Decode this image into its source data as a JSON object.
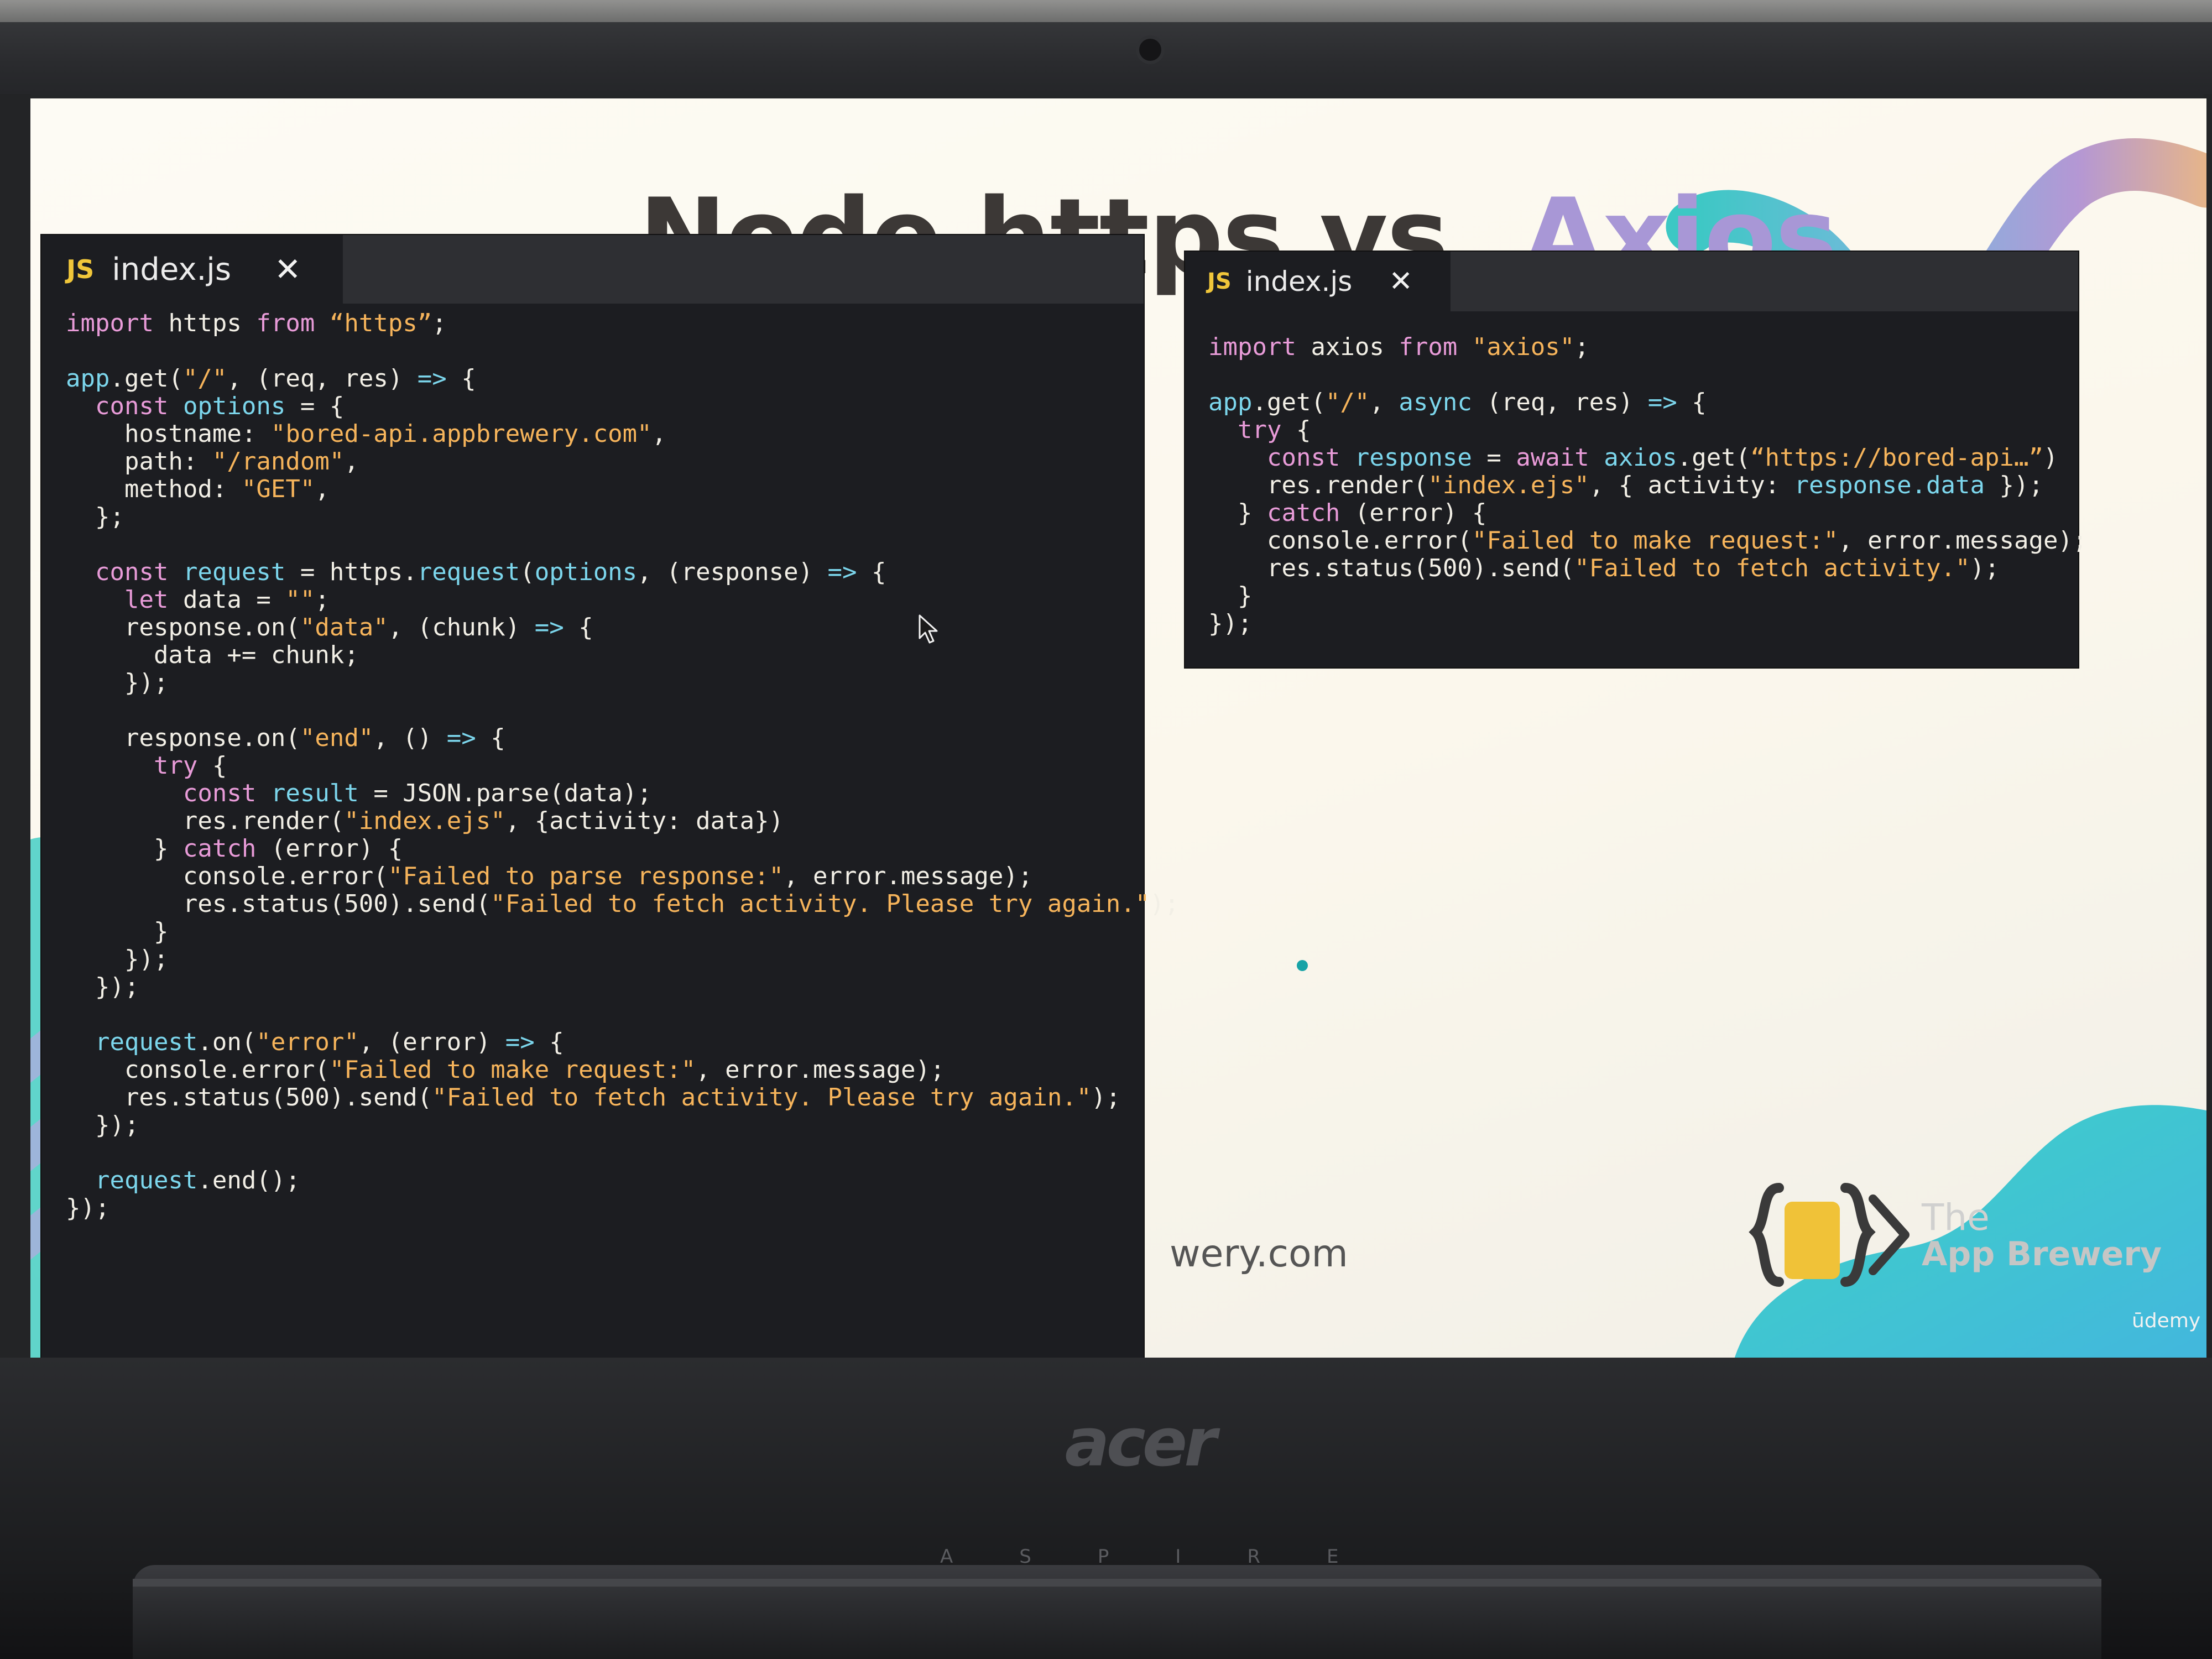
{
  "slide": {
    "title_main": "Node https vs. ",
    "title_accent": "Axios",
    "footer_url": "wery.com",
    "brand_line1": "The",
    "brand_line2": "App Brewery",
    "platform": "ūdemy"
  },
  "laptop": {
    "brand": "acer",
    "series": "ASPIRE"
  },
  "editors": {
    "left": {
      "tab_label": "index.js",
      "tab_icon": "JS",
      "lines": [
        [
          {
            "t": "import",
            "c": "kw"
          },
          {
            "t": " https ",
            "c": "pl"
          },
          {
            "t": "from",
            "c": "kw"
          },
          {
            "t": " “https”",
            "c": "str"
          },
          {
            "t": ";",
            "c": "pl"
          }
        ],
        [],
        [
          {
            "t": "app",
            "c": "var"
          },
          {
            "t": ".get(",
            "c": "pl"
          },
          {
            "t": "\"/\"",
            "c": "str"
          },
          {
            "t": ", (req, res) ",
            "c": "pl"
          },
          {
            "t": "=>",
            "c": "var"
          },
          {
            "t": " {",
            "c": "pl"
          }
        ],
        [
          {
            "t": "  ",
            "c": "pl"
          },
          {
            "t": "const",
            "c": "kw"
          },
          {
            "t": " ",
            "c": "pl"
          },
          {
            "t": "options",
            "c": "var"
          },
          {
            "t": " = {",
            "c": "pl"
          }
        ],
        [
          {
            "t": "    hostname: ",
            "c": "pl"
          },
          {
            "t": "\"bored-api.appbrewery.com\"",
            "c": "str"
          },
          {
            "t": ",",
            "c": "pl"
          }
        ],
        [
          {
            "t": "    path: ",
            "c": "pl"
          },
          {
            "t": "\"/random\"",
            "c": "str"
          },
          {
            "t": ",",
            "c": "pl"
          }
        ],
        [
          {
            "t": "    method: ",
            "c": "pl"
          },
          {
            "t": "\"GET\"",
            "c": "str"
          },
          {
            "t": ",",
            "c": "pl"
          }
        ],
        [
          {
            "t": "  };",
            "c": "pl"
          }
        ],
        [],
        [
          {
            "t": "  ",
            "c": "pl"
          },
          {
            "t": "const",
            "c": "kw"
          },
          {
            "t": " ",
            "c": "pl"
          },
          {
            "t": "request",
            "c": "var"
          },
          {
            "t": " = https.",
            "c": "pl"
          },
          {
            "t": "request",
            "c": "fn"
          },
          {
            "t": "(",
            "c": "pl"
          },
          {
            "t": "options",
            "c": "var"
          },
          {
            "t": ", (response) ",
            "c": "pl"
          },
          {
            "t": "=>",
            "c": "var"
          },
          {
            "t": " {",
            "c": "pl"
          }
        ],
        [
          {
            "t": "    ",
            "c": "pl"
          },
          {
            "t": "let",
            "c": "kw"
          },
          {
            "t": " data = ",
            "c": "pl"
          },
          {
            "t": "\"\"",
            "c": "str"
          },
          {
            "t": ";",
            "c": "pl"
          }
        ],
        [
          {
            "t": "    response.on(",
            "c": "pl"
          },
          {
            "t": "\"data\"",
            "c": "str"
          },
          {
            "t": ", (chunk) ",
            "c": "pl"
          },
          {
            "t": "=>",
            "c": "var"
          },
          {
            "t": " {",
            "c": "pl"
          }
        ],
        [
          {
            "t": "      data += chunk;",
            "c": "pl"
          }
        ],
        [
          {
            "t": "    });",
            "c": "pl"
          }
        ],
        [],
        [
          {
            "t": "    response.on(",
            "c": "pl"
          },
          {
            "t": "\"end\"",
            "c": "str"
          },
          {
            "t": ", () ",
            "c": "pl"
          },
          {
            "t": "=>",
            "c": "var"
          },
          {
            "t": " {",
            "c": "pl"
          }
        ],
        [
          {
            "t": "      ",
            "c": "pl"
          },
          {
            "t": "try",
            "c": "kw"
          },
          {
            "t": " {",
            "c": "pl"
          }
        ],
        [
          {
            "t": "        ",
            "c": "pl"
          },
          {
            "t": "const",
            "c": "kw"
          },
          {
            "t": " ",
            "c": "pl"
          },
          {
            "t": "result",
            "c": "var"
          },
          {
            "t": " = JSON.parse(data);",
            "c": "pl"
          }
        ],
        [
          {
            "t": "        res.render(",
            "c": "pl"
          },
          {
            "t": "\"index.ejs\"",
            "c": "str"
          },
          {
            "t": ", {activity: data})",
            "c": "pl"
          }
        ],
        [
          {
            "t": "      } ",
            "c": "pl"
          },
          {
            "t": "catch",
            "c": "kw"
          },
          {
            "t": " (error) {",
            "c": "pl"
          }
        ],
        [
          {
            "t": "        console.error(",
            "c": "pl"
          },
          {
            "t": "\"Failed to parse response:\"",
            "c": "str"
          },
          {
            "t": ", error.message);",
            "c": "pl"
          }
        ],
        [
          {
            "t": "        res.status(500).send(",
            "c": "pl"
          },
          {
            "t": "\"Failed to fetch activity. Please try again.\"",
            "c": "str"
          },
          {
            "t": ");",
            "c": "pl"
          }
        ],
        [
          {
            "t": "      }",
            "c": "pl"
          }
        ],
        [
          {
            "t": "    });",
            "c": "pl"
          }
        ],
        [
          {
            "t": "  });",
            "c": "pl"
          }
        ],
        [],
        [
          {
            "t": "  ",
            "c": "pl"
          },
          {
            "t": "request",
            "c": "var"
          },
          {
            "t": ".on(",
            "c": "pl"
          },
          {
            "t": "\"error\"",
            "c": "str"
          },
          {
            "t": ", (error) ",
            "c": "pl"
          },
          {
            "t": "=>",
            "c": "var"
          },
          {
            "t": " {",
            "c": "pl"
          }
        ],
        [
          {
            "t": "    console.error(",
            "c": "pl"
          },
          {
            "t": "\"Failed to make request:\"",
            "c": "str"
          },
          {
            "t": ", error.message);",
            "c": "pl"
          }
        ],
        [
          {
            "t": "    res.status(500).send(",
            "c": "pl"
          },
          {
            "t": "\"Failed to fetch activity. Please try again.\"",
            "c": "str"
          },
          {
            "t": ");",
            "c": "pl"
          }
        ],
        [
          {
            "t": "  });",
            "c": "pl"
          }
        ],
        [],
        [
          {
            "t": "  ",
            "c": "pl"
          },
          {
            "t": "request",
            "c": "var"
          },
          {
            "t": ".end();",
            "c": "pl"
          }
        ],
        [
          {
            "t": "});",
            "c": "pl"
          }
        ]
      ]
    },
    "right": {
      "tab_label": "index.js",
      "tab_icon": "JS",
      "lines": [
        [
          {
            "t": "import",
            "c": "kw"
          },
          {
            "t": " axios ",
            "c": "pl"
          },
          {
            "t": "from",
            "c": "kw"
          },
          {
            "t": " \"axios\"",
            "c": "str"
          },
          {
            "t": ";",
            "c": "pl"
          }
        ],
        [],
        [
          {
            "t": "app",
            "c": "var"
          },
          {
            "t": ".get(",
            "c": "pl"
          },
          {
            "t": "\"/\"",
            "c": "str"
          },
          {
            "t": ", ",
            "c": "pl"
          },
          {
            "t": "async",
            "c": "var"
          },
          {
            "t": " (req, res) ",
            "c": "pl"
          },
          {
            "t": "=>",
            "c": "var"
          },
          {
            "t": " {",
            "c": "pl"
          }
        ],
        [
          {
            "t": "  ",
            "c": "pl"
          },
          {
            "t": "try",
            "c": "kw"
          },
          {
            "t": " {",
            "c": "pl"
          }
        ],
        [
          {
            "t": "    ",
            "c": "pl"
          },
          {
            "t": "const",
            "c": "kw"
          },
          {
            "t": " ",
            "c": "pl"
          },
          {
            "t": "response",
            "c": "var"
          },
          {
            "t": " = ",
            "c": "pl"
          },
          {
            "t": "await",
            "c": "kw"
          },
          {
            "t": " ",
            "c": "pl"
          },
          {
            "t": "axios",
            "c": "var"
          },
          {
            "t": ".get(",
            "c": "pl"
          },
          {
            "t": "“https://bored-api…”",
            "c": "str"
          },
          {
            "t": ")",
            "c": "pl"
          }
        ],
        [
          {
            "t": "    res.render(",
            "c": "pl"
          },
          {
            "t": "\"index.ejs\"",
            "c": "str"
          },
          {
            "t": ", { activity: ",
            "c": "pl"
          },
          {
            "t": "response.data",
            "c": "var"
          },
          {
            "t": " });",
            "c": "pl"
          }
        ],
        [
          {
            "t": "  } ",
            "c": "pl"
          },
          {
            "t": "catch",
            "c": "kw"
          },
          {
            "t": " (error) {",
            "c": "pl"
          }
        ],
        [
          {
            "t": "    console.error(",
            "c": "pl"
          },
          {
            "t": "\"Failed to make request:\"",
            "c": "str"
          },
          {
            "t": ", error.message);",
            "c": "pl"
          }
        ],
        [
          {
            "t": "    res.status(500).send(",
            "c": "pl"
          },
          {
            "t": "\"Failed to fetch activity.\"",
            "c": "str"
          },
          {
            "t": ");",
            "c": "pl"
          }
        ],
        [
          {
            "t": "  }",
            "c": "pl"
          }
        ],
        [
          {
            "t": "});",
            "c": "pl"
          }
        ]
      ]
    }
  },
  "colors": {
    "keyword": "#e89bd8",
    "string": "#f6b45b",
    "identifier": "#7cd6ec",
    "plain": "#f2efe6",
    "title_accent": "#a897d6",
    "brand_teal": "#3cc8c4"
  },
  "icons": [
    "webcam",
    "js-file-icon",
    "close-icon",
    "mouse-pointer-icon",
    "app-brewery-logo-icon"
  ]
}
